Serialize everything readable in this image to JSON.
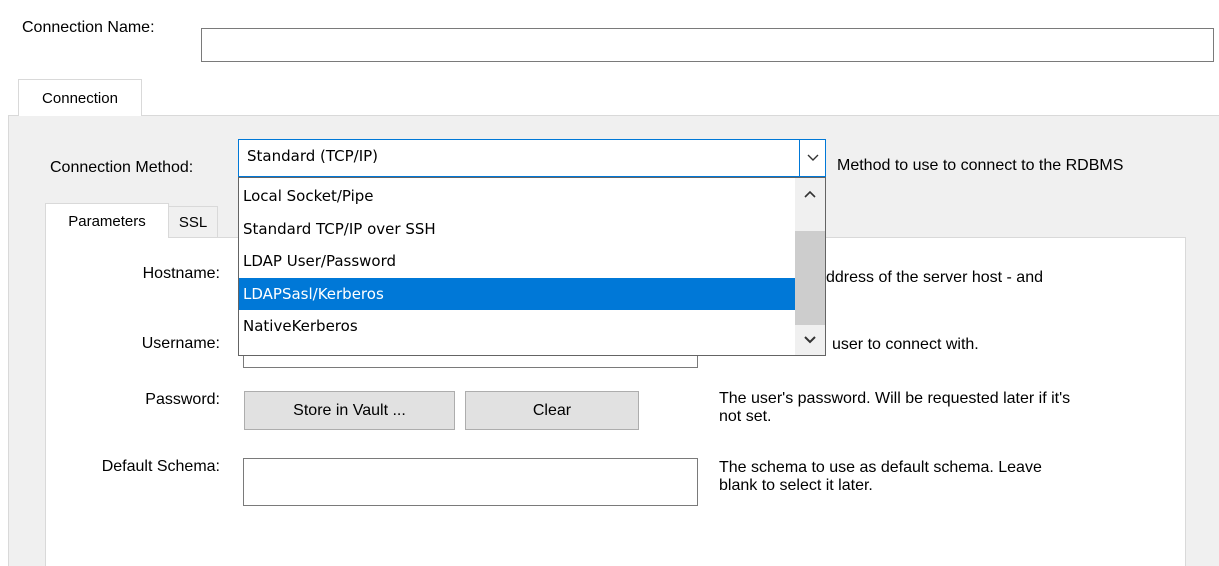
{
  "connection_name": {
    "label": "Connection Name:",
    "value": ""
  },
  "tabs": {
    "connection": "Connection"
  },
  "method": {
    "label": "Connection Method:",
    "selected": "Standard (TCP/IP)",
    "description": "Method to use to connect to the RDBMS",
    "options": [
      {
        "label": "Local Socket/Pipe",
        "selected": false
      },
      {
        "label": "Standard TCP/IP over SSH",
        "selected": false
      },
      {
        "label": "LDAP User/Password",
        "selected": false
      },
      {
        "label": "LDAPSasl/Kerberos",
        "selected": true
      },
      {
        "label": "NativeKerberos",
        "selected": false
      }
    ]
  },
  "subtabs": {
    "parameters": "Parameters",
    "ssl": "SSL"
  },
  "hostname": {
    "label": "Hostname:",
    "description": "ddress of the server host - and"
  },
  "username": {
    "label": "Username:",
    "description": "user to connect with."
  },
  "password": {
    "label": "Password:",
    "store_button": "Store in Vault ...",
    "clear_button": "Clear",
    "description_line1": "The user's password. Will be requested later if it's",
    "description_line2": "not set."
  },
  "default_schema": {
    "label": "Default Schema:",
    "value": "",
    "description_line1": "The schema to use as default schema. Leave",
    "description_line2": "blank to select it later."
  },
  "colors": {
    "selection": "#0078d7",
    "focus_border": "#0078d7",
    "panel_bg": "#f0f0f0"
  }
}
